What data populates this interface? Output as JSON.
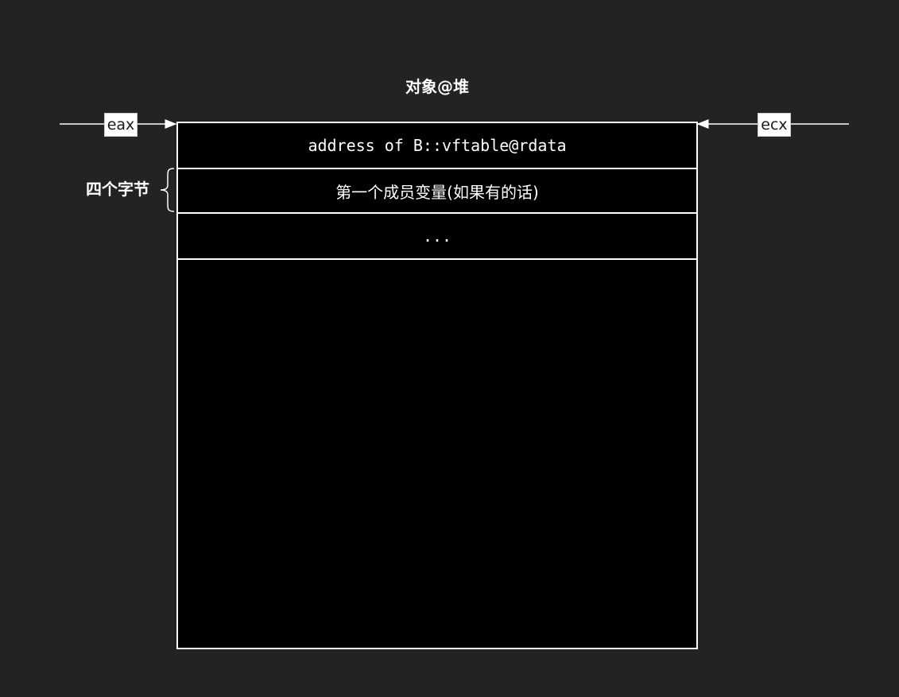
{
  "title": "对象@堆",
  "rows": [
    {
      "label": "address of B::vftable@rdata"
    },
    {
      "label": "第一个成员变量(如果有的话)"
    },
    {
      "label": "..."
    }
  ],
  "registers": {
    "left": "eax",
    "right": "ecx"
  },
  "brace_label": "四个字节",
  "colors": {
    "background": "#232323",
    "box_fill": "#000000",
    "stroke": "#ffffff"
  }
}
